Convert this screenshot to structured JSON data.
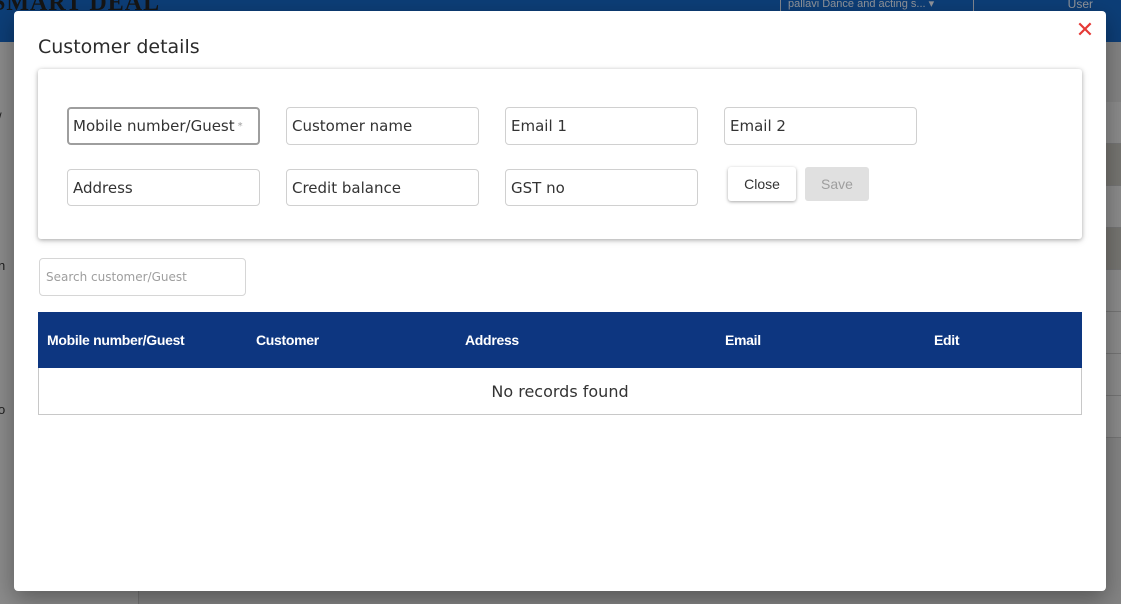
{
  "app": {
    "logo": "SMART DEAL",
    "store_select": "pallavi Dance and acting s...",
    "store_chevron": "chevron-down-icon",
    "user": "User",
    "sidebar_fragments": [
      "/",
      "n",
      "o"
    ]
  },
  "modal": {
    "title": "Customer details",
    "close_icon": "✕"
  },
  "form": {
    "mobile": {
      "placeholder": "Mobile number/Guest",
      "required_mark": "*"
    },
    "customer_name": {
      "placeholder": "Customer name"
    },
    "email1": {
      "placeholder": "Email 1"
    },
    "email2": {
      "placeholder": "Email 2"
    },
    "address": {
      "placeholder": "Address"
    },
    "credit_balance": {
      "placeholder": "Credit balance"
    },
    "gst_no": {
      "placeholder": "GST no"
    },
    "close_label": "Close",
    "save_label": "Save"
  },
  "search": {
    "placeholder": "Search customer/Guest"
  },
  "table": {
    "columns": [
      "Mobile number/Guest",
      "Customer",
      "Address",
      "Email",
      "Edit"
    ],
    "empty_message": "No records found"
  },
  "colors": {
    "header_blue": "#1565c0",
    "table_head": "#0d3680",
    "close_red": "#e53935"
  }
}
